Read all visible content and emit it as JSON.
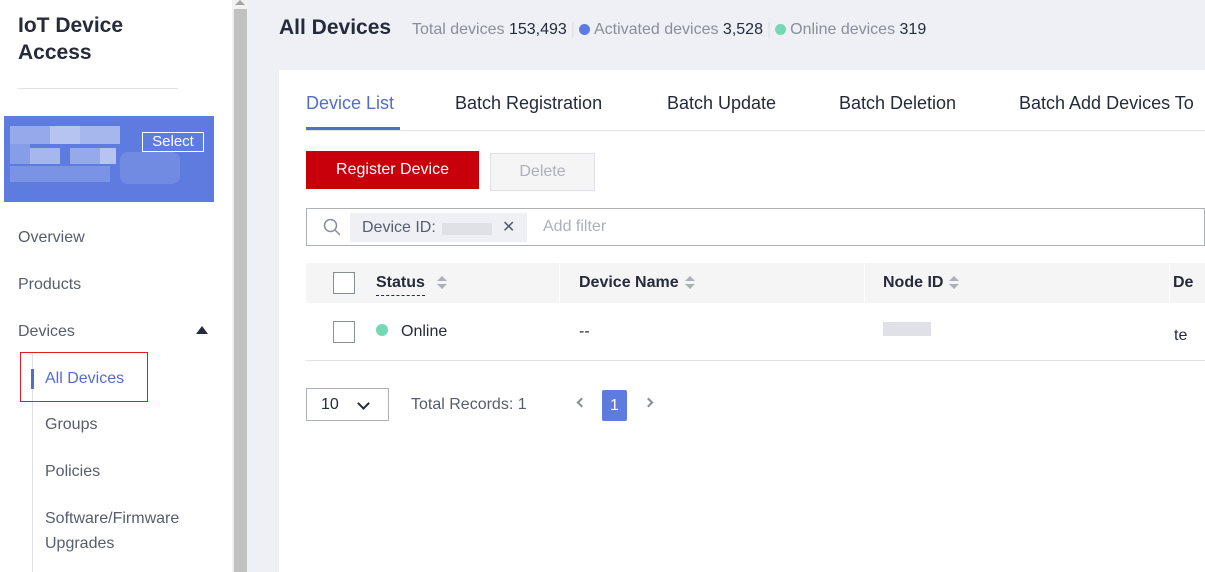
{
  "sidebar": {
    "app_title": "IoT Device Access",
    "instance_select_label": "Select",
    "nav": [
      {
        "label": "Overview"
      },
      {
        "label": "Products"
      },
      {
        "label": "Devices"
      }
    ],
    "devices_submenu": [
      {
        "label": "All Devices",
        "active": true
      },
      {
        "label": "Groups"
      },
      {
        "label": "Policies"
      },
      {
        "label": "Software/Firmware Upgrades"
      }
    ]
  },
  "header": {
    "title": "All Devices",
    "total_label": "Total devices",
    "total_value": "153,493",
    "activated_label": "Activated devices",
    "activated_value": "3,528",
    "online_label": "Online devices",
    "online_value": "319",
    "activated_color": "#5e7ce0",
    "online_color": "#73d9b4"
  },
  "tabs": [
    {
      "label": "Device List",
      "active": true
    },
    {
      "label": "Batch Registration"
    },
    {
      "label": "Batch Update"
    },
    {
      "label": "Batch Deletion"
    },
    {
      "label": "Batch Add Devices To"
    }
  ],
  "toolbar": {
    "register_label": "Register Device",
    "delete_label": "Delete",
    "register_color": "#c7000b"
  },
  "search": {
    "filter_tag_label": "Device ID:",
    "placeholder": "Add filter"
  },
  "table": {
    "columns": [
      "Status",
      "Device Name",
      "Node ID",
      "De"
    ],
    "rows": [
      {
        "status": "Online",
        "device_name": "--",
        "node_id": "",
        "last": "te"
      }
    ]
  },
  "pagination": {
    "page_size": "10",
    "total_label": "Total Records: 1",
    "current_page": "1"
  }
}
